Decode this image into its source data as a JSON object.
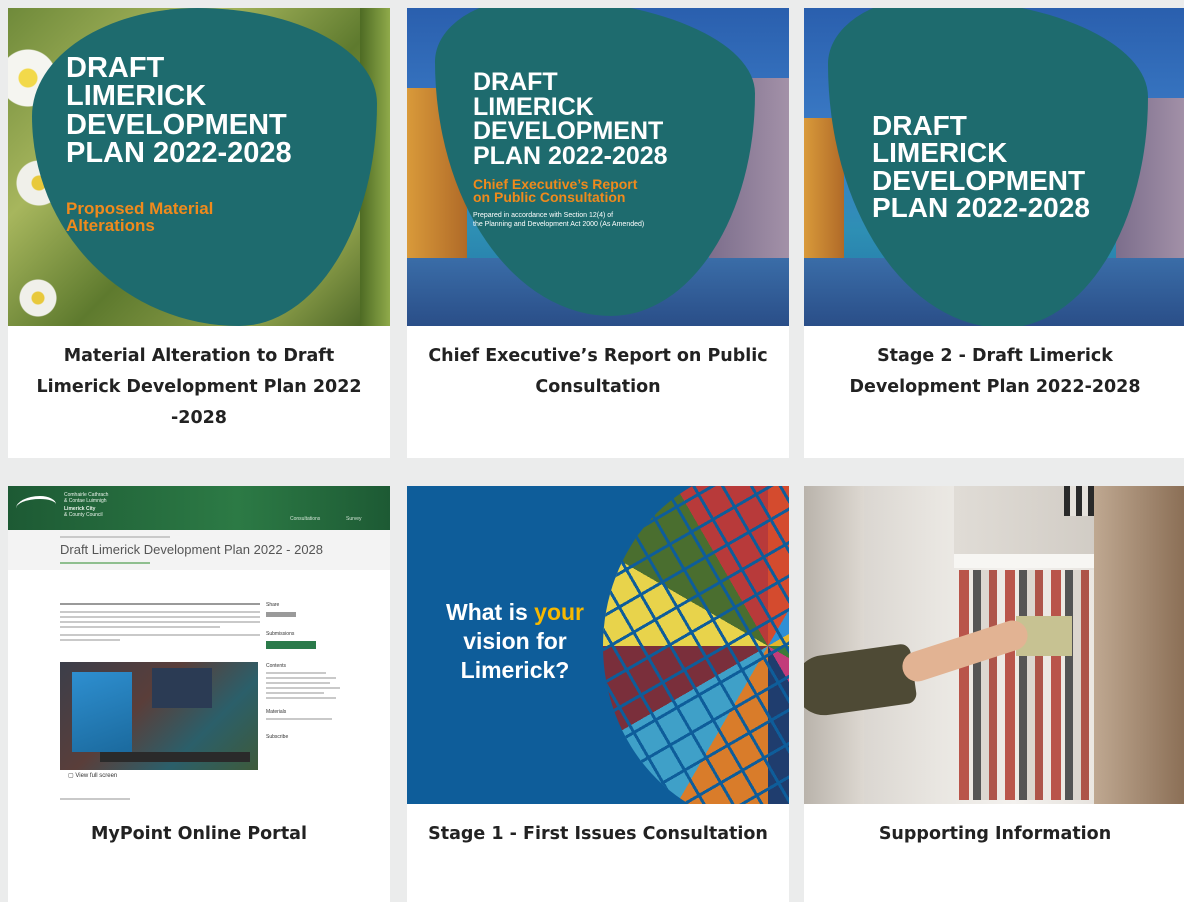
{
  "cards": [
    {
      "title": "Material Alteration to Draft Limerick Development Plan 2022 -2028",
      "cover_title": "DRAFT\nLIMERICK\nDEVELOPMENT\nPLAN 2022-2028",
      "cover_subtitle": "Proposed Material\nAlterations"
    },
    {
      "title": "Chief Executive’s Report on Public Consultation",
      "cover_title": "DRAFT\nLIMERICK\nDEVELOPMENT\nPLAN 2022-2028",
      "cover_subtitle": "Chief Executive’s Report\non Public Consultation",
      "cover_note": "Prepared in accordance with Section 12(4) of\nthe Planning and Development Act 2000 (As Amended)"
    },
    {
      "title": "Stage 2 - Draft Limerick Development Plan 2022-2028",
      "cover_title": "DRAFT\nLIMERICK\nDEVELOPMENT\nPLAN 2022-2028"
    },
    {
      "title": "MyPoint Online Portal",
      "screen": {
        "org_line1": "Comhairle Cathrach",
        "org_line2": "& Contae Luimnigh",
        "org_line3": "Limerick City",
        "org_line4": "& County Council",
        "nav": [
          "Consultations",
          "Survey"
        ],
        "page_title": "Draft Limerick Development Plan 2022 - 2028",
        "share_label": "Share",
        "submissions_label": "Submissions",
        "contents_label": "Contents",
        "materials_label": "Materials",
        "subscribe_label": "Subscribe",
        "view_full_label": "View full screen"
      }
    },
    {
      "title": "Stage 1 - First Issues Consultation",
      "poster": {
        "line1_a": "What is ",
        "line1_b": "your",
        "line2": "vision for",
        "line3": "Limerick?"
      }
    },
    {
      "title": "Supporting Information"
    }
  ],
  "colors": {
    "cover_teal": "#1e6b6e",
    "cover_orange": "#f08a1c",
    "poster_blue": "#0e5d9a",
    "poster_yellow": "#f6b800",
    "page_bg": "#ebecec"
  }
}
